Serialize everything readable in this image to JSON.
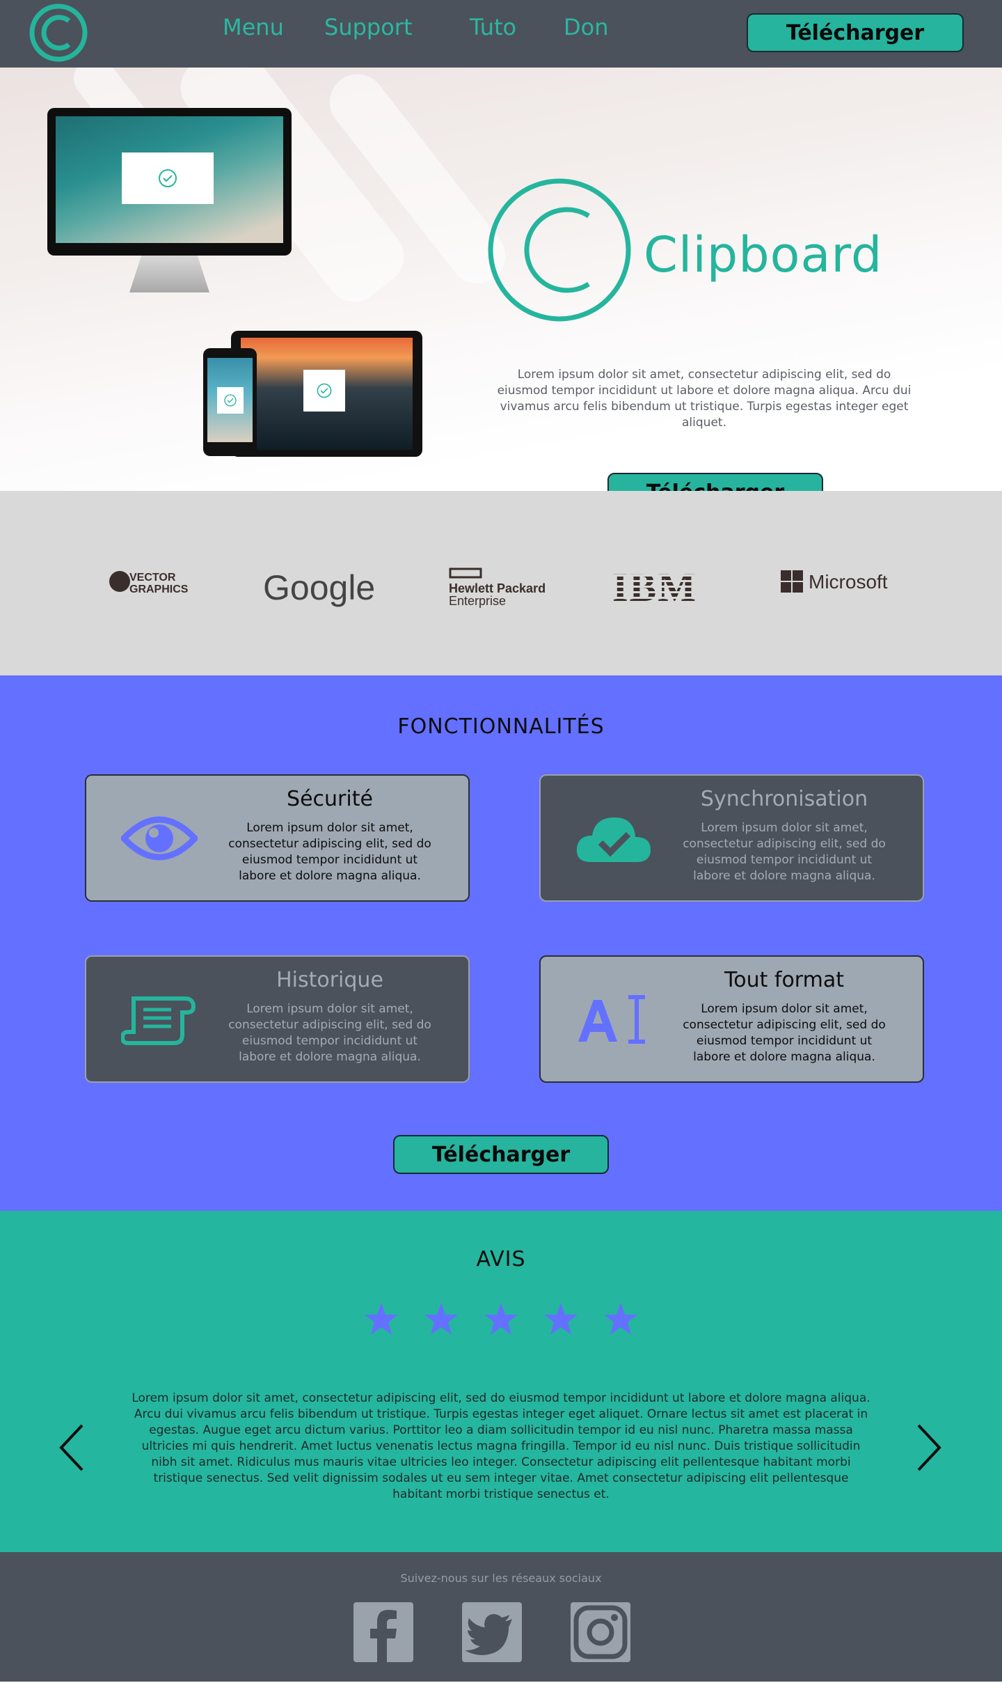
{
  "header": {
    "nav": [
      "Menu",
      "Support",
      "Tuto",
      "Don"
    ],
    "download_label": "Télécharger"
  },
  "hero": {
    "title": "Clipboard",
    "description": "Lorem ipsum dolor sit amet, consectetur adipiscing elit, sed do eiusmod tempor incididunt ut labore et dolore magna aliqua. Arcu dui vivamus arcu felis bibendum ut tristique. Turpis egestas integer eget aliquet.",
    "download_label": "Télécharger"
  },
  "partners": [
    {
      "name": "VECTOR GRAPHICS",
      "icon": "vector-graphics-logo"
    },
    {
      "name": "Google",
      "icon": "google-logo"
    },
    {
      "name": "Hewlett Packard Enterprise",
      "icon": "hpe-logo"
    },
    {
      "name": "IBM",
      "icon": "ibm-logo"
    },
    {
      "name": "Microsoft",
      "icon": "microsoft-logo"
    }
  ],
  "features": {
    "title": "FONCTIONNALITÉS",
    "items": [
      {
        "title": "Sécurité",
        "text": "Lorem ipsum dolor sit amet, consectetur adipiscing elit, sed do eiusmod tempor incididunt ut labore et dolore magna aliqua.",
        "icon": "eye-icon",
        "style": "light"
      },
      {
        "title": "Synchronisation",
        "text": "Lorem ipsum dolor sit amet, consectetur adipiscing elit, sed do eiusmod tempor incididunt ut labore et dolore magna aliqua.",
        "icon": "cloud-check-icon",
        "style": "dark"
      },
      {
        "title": "Historique",
        "text": "Lorem ipsum dolor sit amet, consectetur adipiscing elit, sed do eiusmod tempor incididunt ut labore et dolore magna aliqua.",
        "icon": "scroll-icon",
        "style": "dark"
      },
      {
        "title": "Tout format",
        "text": "Lorem ipsum dolor sit amet, consectetur adipiscing elit, sed do eiusmod tempor incididunt ut labore et dolore magna aliqua.",
        "icon": "text-format-icon",
        "style": "light"
      }
    ],
    "download_label": "Télécharger"
  },
  "reviews": {
    "title": "AVIS",
    "rating": 5,
    "text": "Lorem ipsum dolor sit amet, consectetur adipiscing elit, sed do eiusmod tempor incididunt ut labore et dolore magna aliqua. Arcu dui vivamus arcu felis bibendum ut tristique. Turpis egestas integer eget aliquet. Ornare lectus sit amet est placerat in egestas. Augue eget arcu dictum varius. Porttitor leo a diam sollicitudin tempor id eu nisl nunc. Pharetra massa massa ultricies mi quis hendrerit. Amet luctus venenatis lectus magna fringilla. Tempor id eu nisl nunc. Duis tristique sollicitudin nibh sit amet. Ridiculus mus mauris vitae ultricies leo integer. Consectetur adipiscing elit pellentesque habitant morbi tristique senectus. Sed velit dignissim sodales ut eu sem integer vitae. Amet consectetur adipiscing elit pellentesque habitant morbi tristique senectus et."
  },
  "footer": {
    "text": "Suivez-nous sur les réseaux sociaux",
    "socials": [
      "facebook-icon",
      "twitter-icon",
      "instagram-icon"
    ]
  },
  "colors": {
    "teal": "#25b59d",
    "dark": "#4b525c",
    "blue": "#6470ff",
    "grey": "#d9d9d9"
  }
}
